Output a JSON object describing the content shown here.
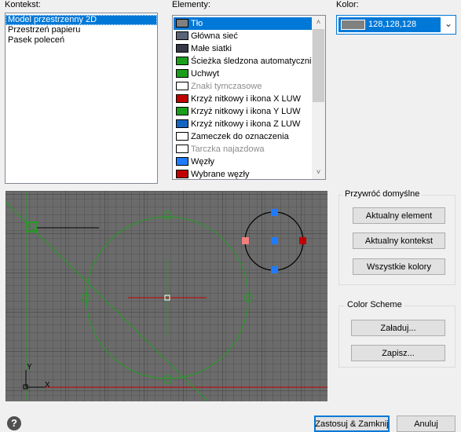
{
  "kontekst": {
    "label": "Kontekst:",
    "items": [
      "Model przestrzenny 2D",
      "Przestrzeń papieru",
      "Pasek poleceń"
    ],
    "selected_index": 0
  },
  "elementy": {
    "label": "Elementy:",
    "items": [
      {
        "label": "Tło",
        "swatch": "#808080",
        "selected": true,
        "dim": false
      },
      {
        "label": "Główna sieć",
        "swatch": "#5a6478",
        "selected": false,
        "dim": false
      },
      {
        "label": "Małe siatki",
        "swatch": "#353845",
        "selected": false,
        "dim": false
      },
      {
        "label": "Ścieżka śledzona automatycznie",
        "swatch": "#1b9e1b",
        "selected": false,
        "dim": false
      },
      {
        "label": "Uchwyt",
        "swatch": "#1b9e1b",
        "selected": false,
        "dim": false
      },
      {
        "label": "Znaki tymczasowe",
        "swatch": "#ffffff",
        "selected": false,
        "dim": true
      },
      {
        "label": "Krzyż nitkowy i ikona X LUW",
        "swatch": "#c00000",
        "selected": false,
        "dim": false
      },
      {
        "label": "Krzyż nitkowy i ikona Y LUW",
        "swatch": "#1b9e1b",
        "selected": false,
        "dim": false
      },
      {
        "label": "Krzyż nitkowy i ikona Z LUW",
        "swatch": "#1565c0",
        "selected": false,
        "dim": false
      },
      {
        "label": "Zameczek do oznaczenia",
        "swatch": "#ffffff",
        "selected": false,
        "dim": false
      },
      {
        "label": "Tarczka najazdowa",
        "swatch": "#ffffff",
        "selected": false,
        "dim": true
      },
      {
        "label": "Węzły",
        "swatch": "#1e7bff",
        "selected": false,
        "dim": false
      },
      {
        "label": "Wybrane węzły",
        "swatch": "#c00000",
        "selected": false,
        "dim": false
      }
    ]
  },
  "kolor": {
    "label": "Kolor:",
    "value": "128,128,128",
    "swatch": "#808080"
  },
  "preview": {
    "background": "#6b6b6b",
    "axis_y_label": "Y",
    "axis_x_label": "X"
  },
  "restore_group": {
    "title": "Przywróć domyślne",
    "buttons": [
      "Aktualny element",
      "Aktualny kontekst",
      "Wszystkie kolory"
    ]
  },
  "scheme_group": {
    "title": "Color Scheme",
    "buttons": [
      "Załaduj...",
      "Zapisz..."
    ]
  },
  "footer": {
    "help_icon_glyph": "?",
    "apply_close": "Zastosuj & Zamknij",
    "cancel": "Anuluj"
  }
}
